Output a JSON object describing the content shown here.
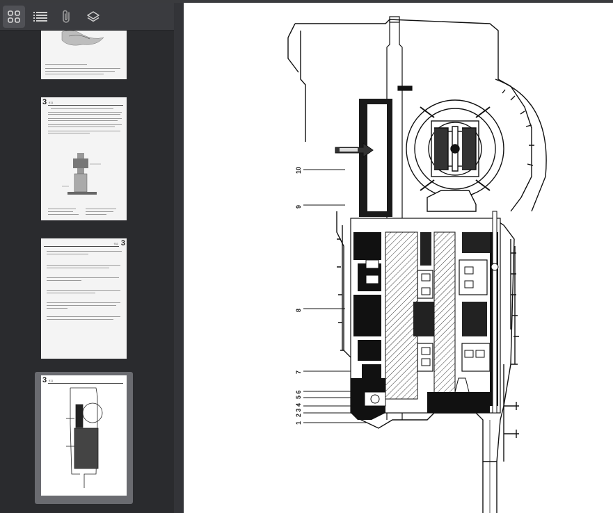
{
  "toolbar": {
    "buttons": [
      {
        "name": "thumbnails",
        "icon": "grid-icon",
        "active": true
      },
      {
        "name": "outline",
        "icon": "list-icon",
        "active": false
      },
      {
        "name": "attachments",
        "icon": "paperclip-icon",
        "active": false
      },
      {
        "name": "layers",
        "icon": "layers-icon",
        "active": false
      }
    ]
  },
  "thumbnails": [
    {
      "page_marker": "",
      "header": ""
    },
    {
      "page_marker": "3",
      "header": "911"
    },
    {
      "page_marker": "3",
      "header": "911"
    },
    {
      "page_marker": "3",
      "header": "911"
    }
  ],
  "drawing": {
    "callouts": [
      "10",
      "9",
      "8",
      "7",
      "5 6",
      "2 3 4",
      "1"
    ]
  },
  "colors": {
    "sidebar_bg": "#2a2b2e",
    "toolbar_bg": "#3a3b3f",
    "selected_frame": "#6a6b70",
    "page_bg": "#ffffff"
  }
}
